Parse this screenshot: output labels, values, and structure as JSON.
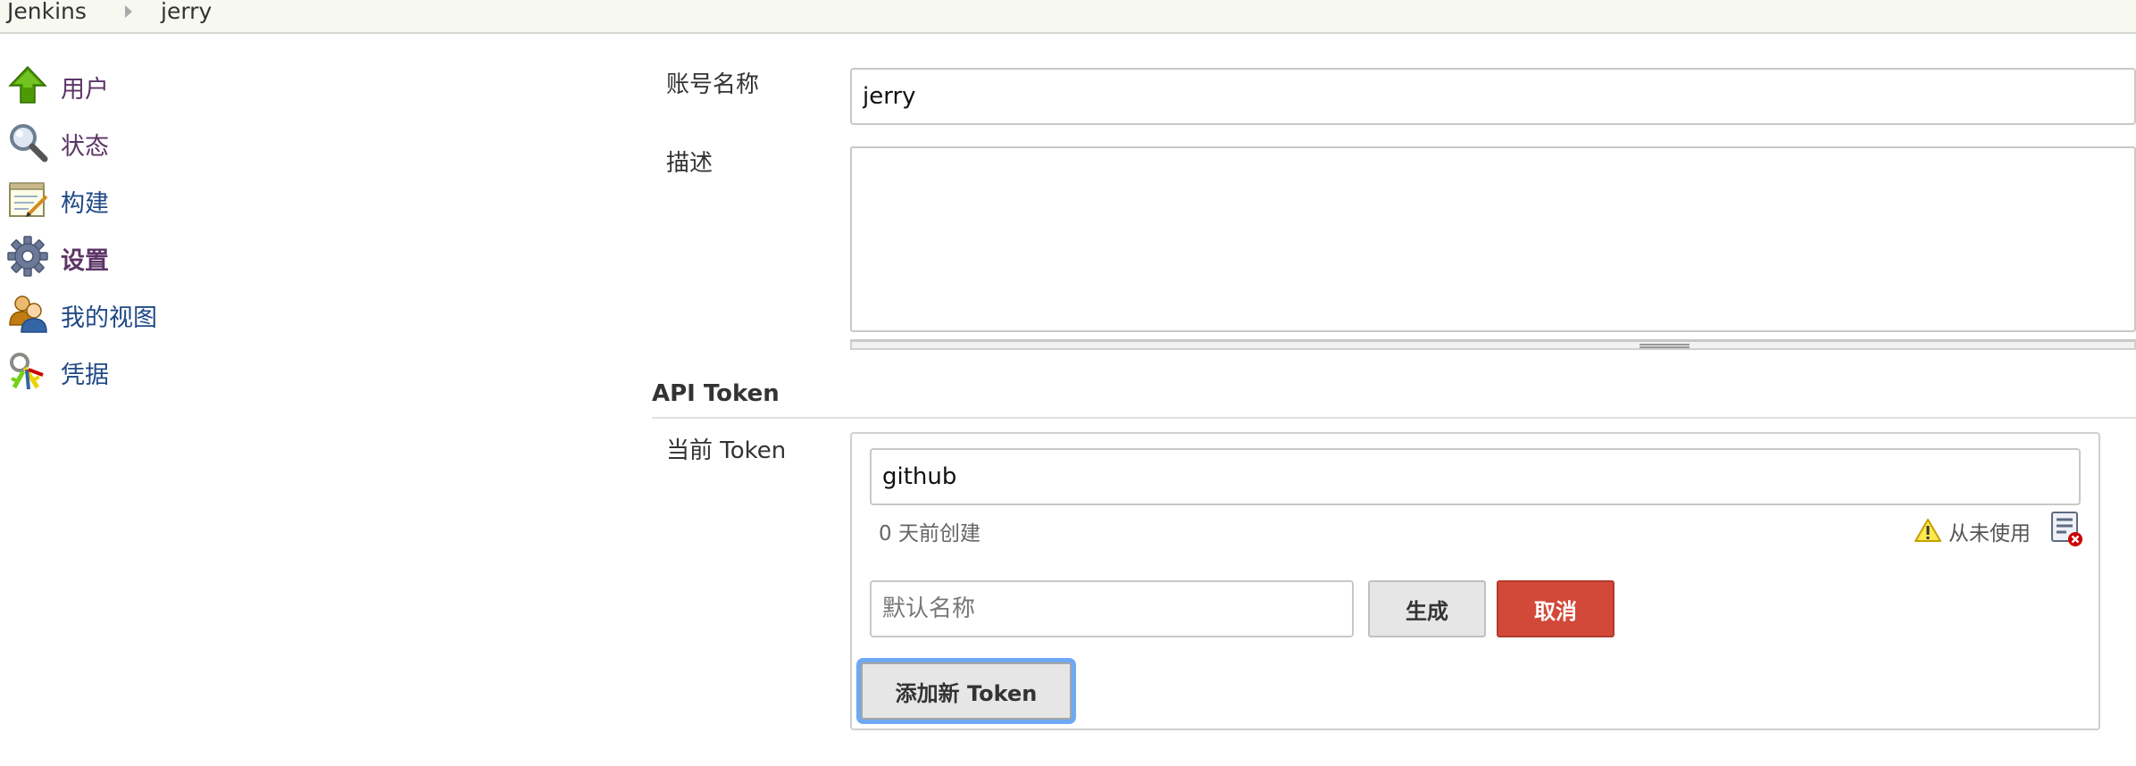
{
  "breadcrumb": {
    "items": [
      "Jenkins",
      "jerry"
    ]
  },
  "sidebar": {
    "items": [
      {
        "label": "用户",
        "icon": "up-arrow-icon"
      },
      {
        "label": "状态",
        "icon": "magnifier-icon"
      },
      {
        "label": "构建",
        "icon": "notepad-icon"
      },
      {
        "label": "设置",
        "icon": "gear-icon"
      },
      {
        "label": "我的视图",
        "icon": "users-icon"
      },
      {
        "label": "凭据",
        "icon": "keys-icon"
      }
    ]
  },
  "form": {
    "account_label": "账号名称",
    "account_value": "jerry",
    "description_label": "描述",
    "description_value": ""
  },
  "api_token": {
    "section_title": "API Token",
    "current_label": "当前 Token",
    "token_name": "github",
    "created_text": "0 天前创建",
    "usage_text": "从未使用",
    "new_token_placeholder": "默认名称",
    "generate_label": "生成",
    "cancel_label": "取消",
    "add_label": "添加新 Token"
  },
  "colors": {
    "link": "#204a87",
    "visited": "#5c3566",
    "cancel": "#d24939",
    "focus_ring": "#6fa8f3"
  }
}
